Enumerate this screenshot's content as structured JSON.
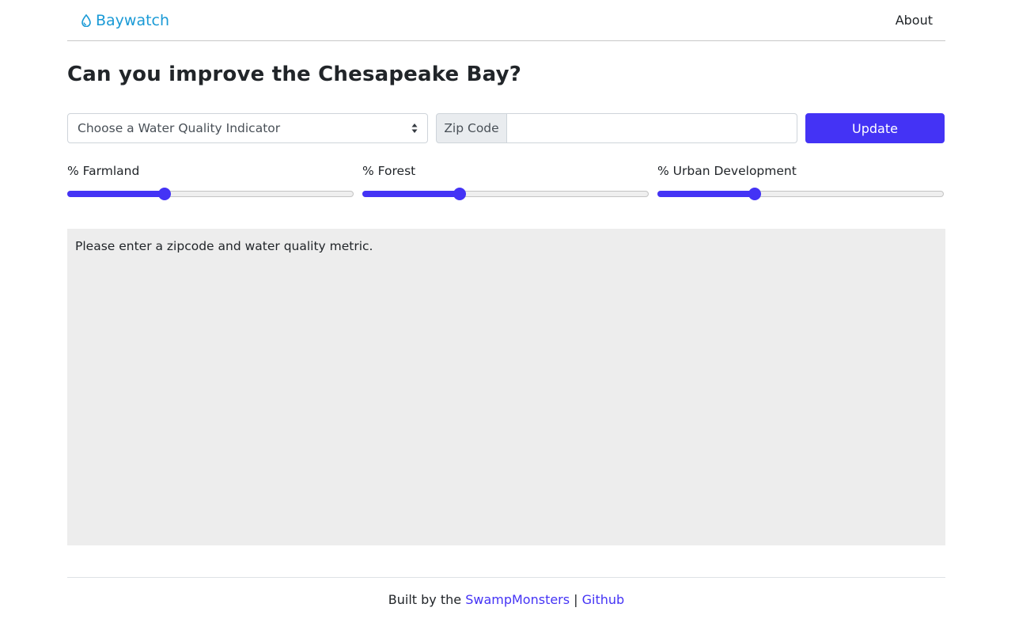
{
  "navbar": {
    "brand": "Baywatch",
    "brand_icon": "water-drop-icon",
    "about": "About"
  },
  "page": {
    "title": "Can you improve the Chesapeake Bay?"
  },
  "controls": {
    "indicator_select": "Choose a Water Quality Indicator",
    "zip_label": "Zip Code",
    "zip_value": "",
    "update_label": "Update"
  },
  "sliders": [
    {
      "label": "% Farmland",
      "value_percent": 34
    },
    {
      "label": "% Forest",
      "value_percent": 34
    },
    {
      "label": "% Urban Development",
      "value_percent": 34
    }
  ],
  "result": {
    "message": "Please enter a zipcode and water quality metric."
  },
  "footer": {
    "prefix": "Built by the ",
    "team_link": "SwampMonsters",
    "separator": " | ",
    "github_link": "Github"
  },
  "colors": {
    "accent": "#4433f5",
    "brand": "#1a9ad6",
    "panel_bg": "#ededed"
  }
}
